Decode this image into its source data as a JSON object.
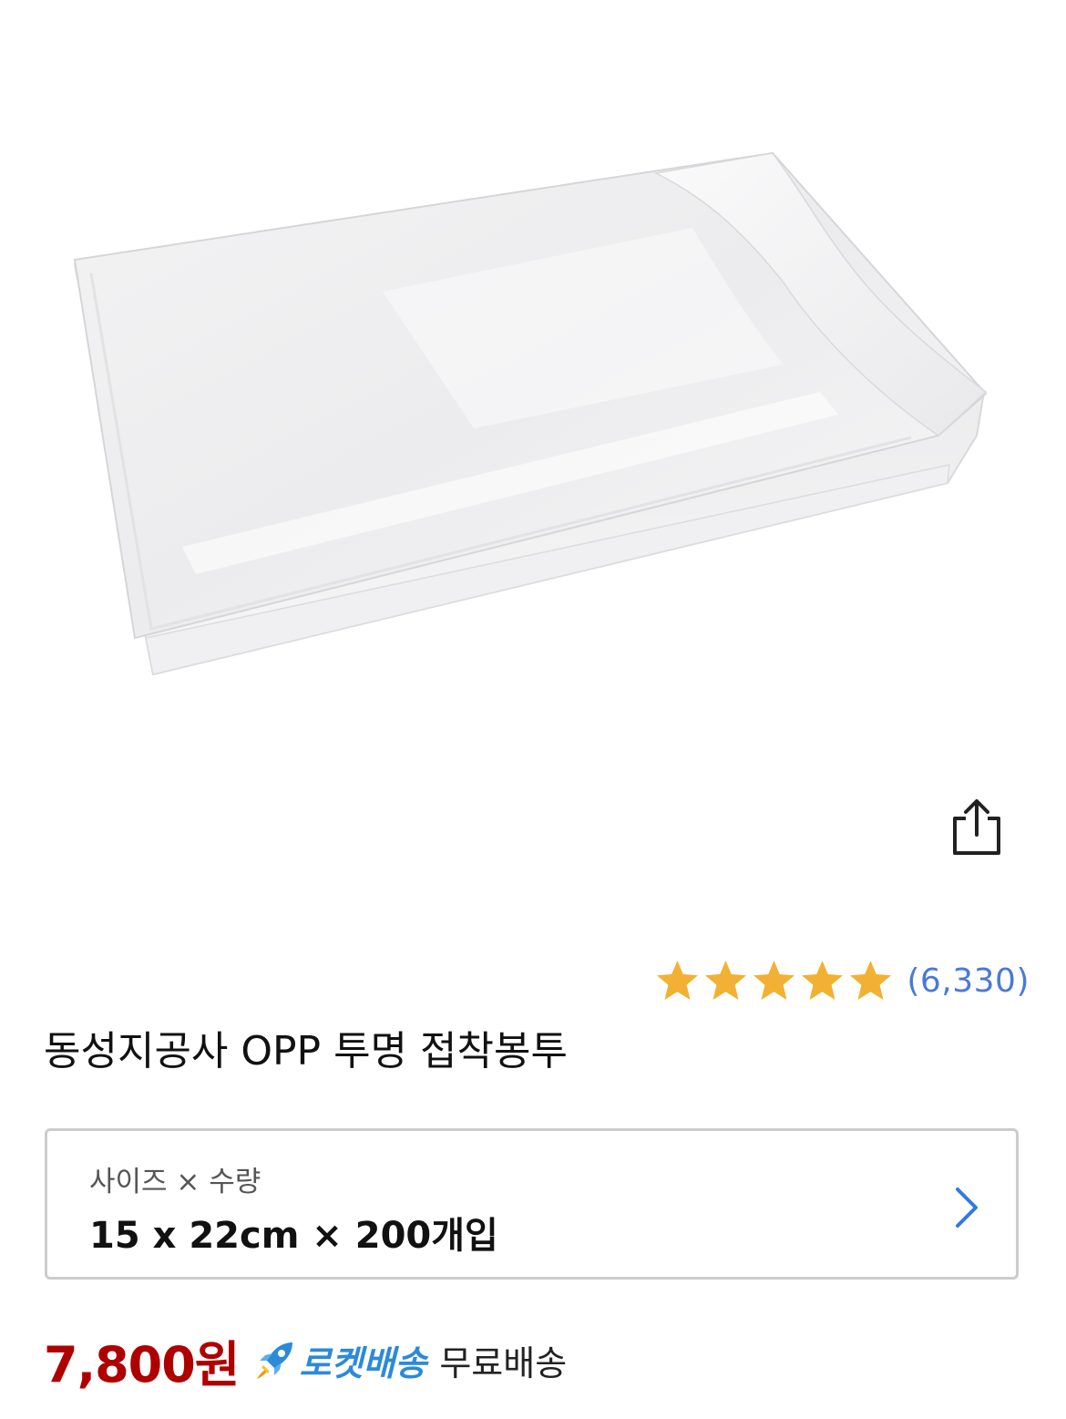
{
  "product": {
    "title": "동성지공사 OPP 투명 접착봉투",
    "image_alt": "OPP 투명 접착봉투"
  },
  "rating": {
    "stars": 5,
    "max_stars": 5,
    "review_count": "(6,330)",
    "star_color": "#f2b134"
  },
  "option": {
    "label": "사이즈 × 수량",
    "value": "15 x 22cm × 200개입"
  },
  "pricing": {
    "price": "7,800원",
    "price_color": "#ae0000",
    "delivery_badge": "로켓배송",
    "delivery_badge_color": "#2c8ad8",
    "shipping": "무료배송"
  },
  "icons": {
    "share": "share-icon",
    "star": "star-icon",
    "chevron": "chevron-right-icon",
    "rocket": "rocket-icon"
  }
}
